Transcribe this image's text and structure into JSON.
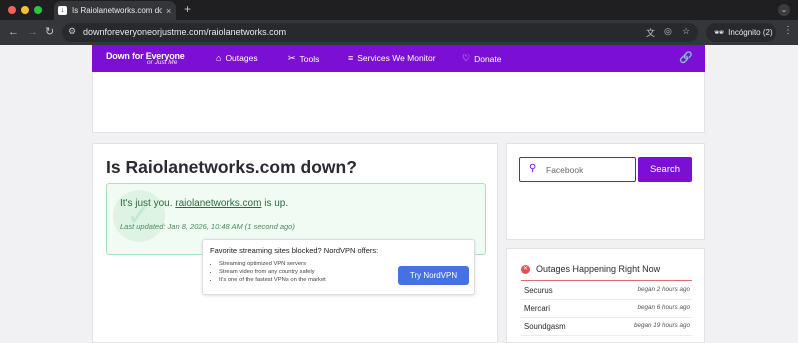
{
  "browser": {
    "tab_title": "Is Raiolanetworks.com down?",
    "url": "downforeveryoneorjustme.com/raiolanetworks.com",
    "incognito_label": "Incógnito (2)"
  },
  "nav": {
    "logo_main": "Down for Everyone",
    "logo_sub": "or Just Me",
    "items": [
      "Outages",
      "Tools",
      "Services We Monitor",
      "Donate"
    ]
  },
  "main": {
    "heading": "Is Raiolanetworks.com down?",
    "status_prefix": "It's just you.",
    "status_link": "raiolanetworks.com",
    "status_suffix": "is up.",
    "last_updated": "Last updated: Jan 8, 2026, 10:48 AM (1 second ago)"
  },
  "vpn": {
    "title": "Favorite streaming sites blocked? NordVPN offers:",
    "bullets": [
      "Streaming optimized VPN servers",
      "Stream video from any country safely",
      "It's one of the fastest VPNs on the market"
    ],
    "button": "Try NordVPN"
  },
  "search": {
    "placeholder": "Facebook",
    "button": "Search"
  },
  "outages": {
    "title": "Outages Happening Right Now",
    "rows": [
      {
        "name": "Securus",
        "when": "began 2 hours ago"
      },
      {
        "name": "Mercari",
        "when": "began 6 hours ago"
      },
      {
        "name": "Soundgasm",
        "when": "began 19 hours ago"
      }
    ]
  },
  "colors": {
    "brand": "#7c0fd4",
    "success_bg": "#f0fbf3",
    "success_border": "#a8e4b8",
    "vpn_button": "#4572e3",
    "outage_icon": "#e35252"
  }
}
